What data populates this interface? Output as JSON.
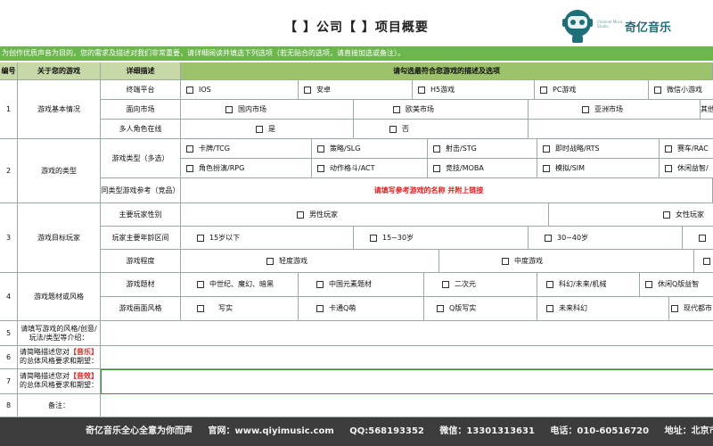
{
  "header": {
    "title": "【 】公司【 】项目概要",
    "logo_text": "奇亿音乐",
    "logo_sub": "Channel Music Studio"
  },
  "notice": "为创作优质声音为目的，您的需求及描述对我们非常重要，请详细阅读并填选下列选项（若无贴合的选项，请直接加选或备注）。",
  "table": {
    "headers": {
      "num": "编号",
      "about": "关于您的游戏",
      "detail": "详细描述",
      "choose": "请勾选最符合您游戏的描述及选项"
    },
    "sections": {
      "s1": {
        "num": "1",
        "title": "游戏基本情况"
      },
      "s2": {
        "num": "2",
        "title": "游戏的类型"
      },
      "s3": {
        "num": "3",
        "title": "游戏目标玩家"
      },
      "s4": {
        "num": "4",
        "title": "游戏题材或风格"
      },
      "s5": {
        "num": "5",
        "title": "请填写游戏的风格/创意/玩法/类型等介绍："
      },
      "s6": {
        "num": "6",
        "title_pre": "请简略描述您对",
        "title_tag": "【音乐】",
        "title_post": "的总体风格要求和期望："
      },
      "s7": {
        "num": "7",
        "title_pre": "请简略描述您对",
        "title_tag": "【音效】",
        "title_post": "的总体风格要求和期望："
      },
      "s8": {
        "num": "8",
        "title": "备注："
      }
    },
    "rows": {
      "platform": {
        "label": "终端平台",
        "options": [
          "IOS",
          "安卓",
          "H5游戏",
          "PC游戏",
          "微信小游戏"
        ]
      },
      "market": {
        "label": "面向市场",
        "options": [
          "国内市场",
          "欧美市场",
          "亚洲市场",
          "其他"
        ]
      },
      "multiplayer": {
        "label": "多人角色在线",
        "options": [
          "是",
          "否"
        ]
      },
      "genre": {
        "label": "游戏类型（多选）",
        "options_a": [
          "卡牌/TCG",
          "策略/SLG",
          "射击/STG",
          "即时战略/RTS",
          "赛车/RAC"
        ],
        "options_b": [
          "角色扮演/RPG",
          "动作格斗/ACT",
          "竞技/MOBA",
          "模拟/SIM",
          "休闲益智/"
        ]
      },
      "reference": {
        "label": "同类型游戏参考（竞品）",
        "hint": "请填写参考游戏的名称 并附上链接"
      },
      "gender": {
        "label": "主要玩家性别",
        "options": [
          "男性玩家",
          "女性玩家"
        ]
      },
      "age": {
        "label": "玩家主要年龄区间",
        "options": [
          "15岁以下",
          "15~30岁",
          "30~40岁",
          ""
        ]
      },
      "degree": {
        "label": "游戏程度",
        "options": [
          "轻度游戏",
          "中度游戏",
          ""
        ]
      },
      "theme": {
        "label": "游戏题材",
        "options": [
          "中世纪、魔幻、暗黑",
          "中国元素题材",
          "二次元",
          "科幻/未来/机械",
          "休闲Q版益智"
        ]
      },
      "art": {
        "label": "游戏画面风格",
        "options": [
          "写实",
          "卡通Q萌",
          "Q版写实",
          "未来科幻",
          "现代都市"
        ]
      }
    }
  },
  "footer": {
    "slogan": "奇亿音乐全心全意为你而声",
    "site": "官网：www.qiyimusic.com",
    "qq": "QQ:568193352",
    "wechat": "微信：13301313631",
    "phone": "电话：010-60516720",
    "address": "地址：北京市通州区世"
  }
}
